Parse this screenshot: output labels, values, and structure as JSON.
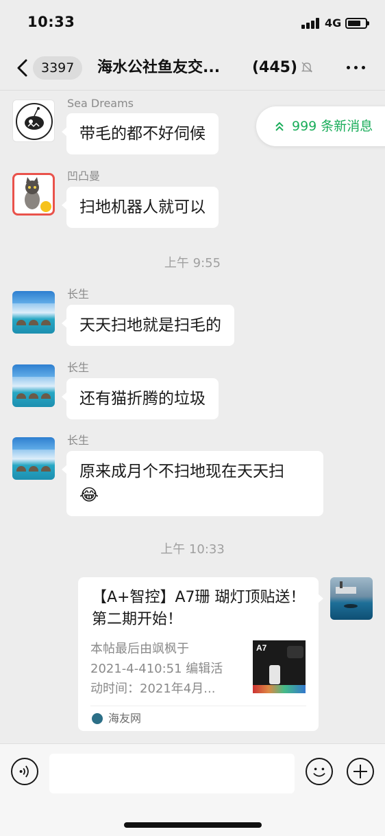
{
  "status_bar": {
    "time": "10:33",
    "network": "4G"
  },
  "nav": {
    "unread_count": "3397",
    "title": "海水公社鱼友交...",
    "member_count": "(445)"
  },
  "new_messages": {
    "label": "999 条新消息"
  },
  "messages": [
    {
      "sender": "Sea Dreams",
      "text": "带毛的都不好伺候",
      "avatar": "big-fish-avatar"
    },
    {
      "sender": "凹凸曼",
      "text": "扫地机器人就可以",
      "avatar": "cat-cartoon-avatar"
    },
    {
      "sender": "长生",
      "text": "天天扫地就是扫毛的",
      "avatar": "ocean-avatar"
    },
    {
      "sender": "长生",
      "text": "还有猫折腾的垃圾",
      "avatar": "ocean-avatar"
    },
    {
      "sender": "长生",
      "text": "原来成月个不扫地现在天天扫",
      "emoji": "😂",
      "avatar": "ocean-avatar"
    }
  ],
  "timestamps": [
    "上午 9:55",
    "上午 10:33"
  ],
  "link_card": {
    "title": "【A+智控】A7珊 瑚灯顶贴送！第二期开始！",
    "description_lines": [
      "本帖最后由飒枫于",
      "2021-4-410:51 编辑活",
      "动时间：2021年4月..."
    ],
    "thumb_label": "A7",
    "source": "海友网"
  },
  "colors": {
    "accent_green": "#1aad5a",
    "chat_bg": "#ededed"
  }
}
